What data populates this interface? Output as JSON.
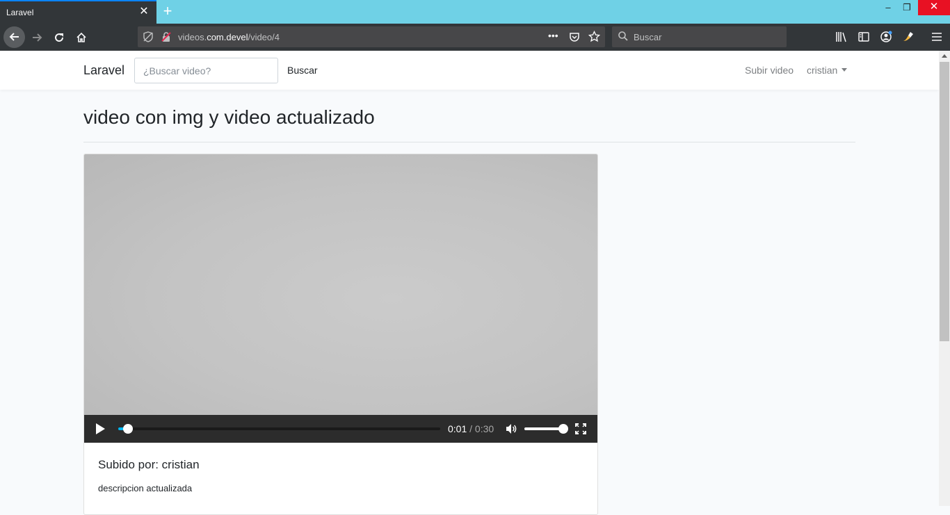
{
  "browser": {
    "tab_title": "Laravel",
    "tab_close": "✕",
    "new_tab": "+",
    "window_controls": {
      "minimize": "–",
      "restore": "❐",
      "close": "✕"
    },
    "url_prefix": "videos.",
    "url_host": "com.devel",
    "url_path": "/video/4",
    "page_actions": "•••",
    "search_placeholder": "Buscar",
    "icons": [
      "back-icon",
      "forward-icon",
      "reload-icon",
      "home-icon",
      "tracking-shield-icon",
      "insecure-lock-icon",
      "pocket-icon",
      "bookmark-star-icon",
      "library-icon",
      "sidebar-icon",
      "account-icon",
      "extension-icon",
      "menu-icon"
    ]
  },
  "navbar": {
    "brand": "Laravel",
    "search_placeholder": "¿Buscar video?",
    "search_button": "Buscar",
    "upload_link": "Subir video",
    "user_menu": "cristian"
  },
  "main": {
    "title": "video con img y video actualizado",
    "player": {
      "current_time": "0:01",
      "separator": " / ",
      "duration": "0:30",
      "progress_fraction": 0.03,
      "volume_fraction": 1.0,
      "accent_color": "#00b6f0"
    },
    "uploaded_by": "Subido por: cristian",
    "description": "descripcion actualizada"
  }
}
